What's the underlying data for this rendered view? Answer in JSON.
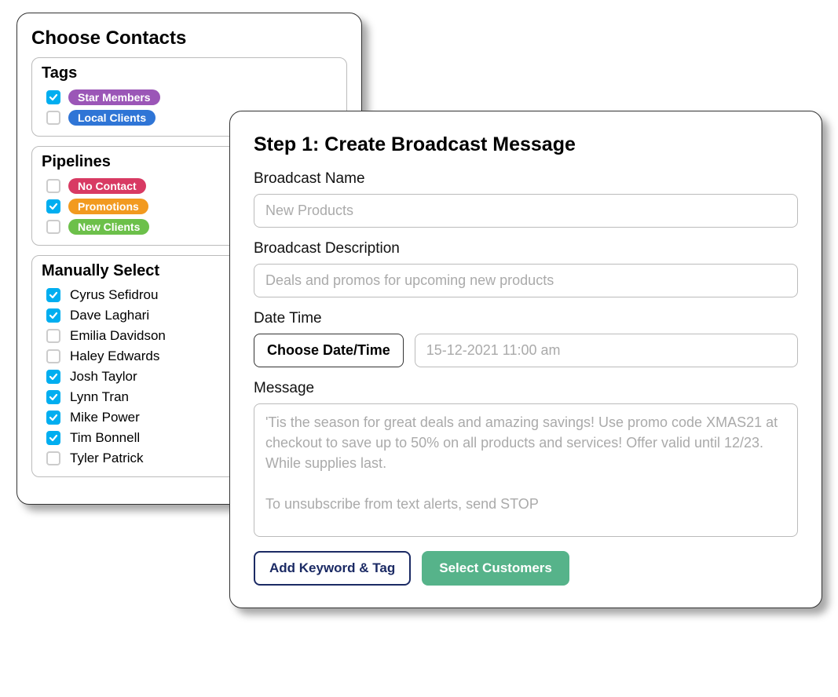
{
  "contacts": {
    "title": "Choose Contacts",
    "tags": {
      "title": "Tags",
      "items": [
        {
          "label": "Star Members",
          "checked": true,
          "color": "#9b56b7"
        },
        {
          "label": "Local Clients",
          "checked": false,
          "color": "#2f75d6"
        }
      ]
    },
    "pipelines": {
      "title": "Pipelines",
      "items": [
        {
          "label": "No Contact",
          "checked": false,
          "color": "#d83a63"
        },
        {
          "label": "Promotions",
          "checked": true,
          "color": "#f29a1f"
        },
        {
          "label": "New Clients",
          "checked": false,
          "color": "#6cc04a"
        }
      ]
    },
    "manual": {
      "title": "Manually Select",
      "items": [
        {
          "name": "Cyrus Sefidrou",
          "checked": true
        },
        {
          "name": "Dave Laghari",
          "checked": true
        },
        {
          "name": "Emilia Davidson",
          "checked": false
        },
        {
          "name": "Haley Edwards",
          "checked": false
        },
        {
          "name": "Josh Taylor",
          "checked": true
        },
        {
          "name": "Lynn Tran",
          "checked": true
        },
        {
          "name": "Mike Power",
          "checked": true
        },
        {
          "name": "Tim Bonnell",
          "checked": true
        },
        {
          "name": "Tyler Patrick",
          "checked": false
        }
      ]
    }
  },
  "broadcast": {
    "title": "Step 1: Create Broadcast Message",
    "name_label": "Broadcast Name",
    "name_value": "New Products",
    "desc_label": "Broadcast Description",
    "desc_value": "Deals and promos for upcoming new products",
    "dt_label": "Date Time",
    "dt_button": "Choose Date/Time",
    "dt_value": "15-12-2021 11:00 am",
    "msg_label": "Message",
    "msg_value": "'Tis the season for great deals and amazing savings! Use promo code XMAS21 at checkout to save up to 50% on all products and services! Offer valid until 12/23. While supplies last.\n\nTo unsubscribe from text alerts, send STOP",
    "add_kw_label": "Add Keyword & Tag",
    "select_cust_label": "Select Customers"
  }
}
